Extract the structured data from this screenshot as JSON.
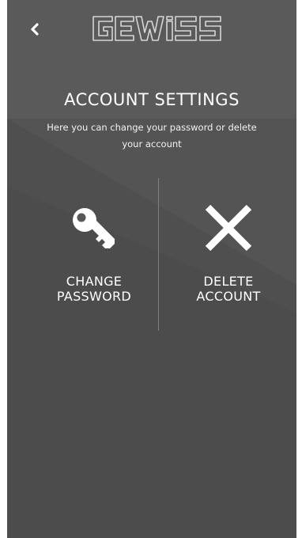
{
  "header": {
    "back_icon": "chevron-left-icon",
    "logo_text": "GEWISS"
  },
  "page": {
    "title": "ACCOUNT SETTINGS",
    "subtitle": "Here you can change your password or delete your account"
  },
  "actions": [
    {
      "icon": "key-icon",
      "label_line1": "CHANGE",
      "label_line2": "PASSWORD"
    },
    {
      "icon": "close-x-icon",
      "label_line1": "DELETE",
      "label_line2": "ACCOUNT"
    }
  ],
  "colors": {
    "background": "#565656",
    "background_lower": "#4c4c4c",
    "text": "#ffffff",
    "divider": "#7e7e7e"
  }
}
